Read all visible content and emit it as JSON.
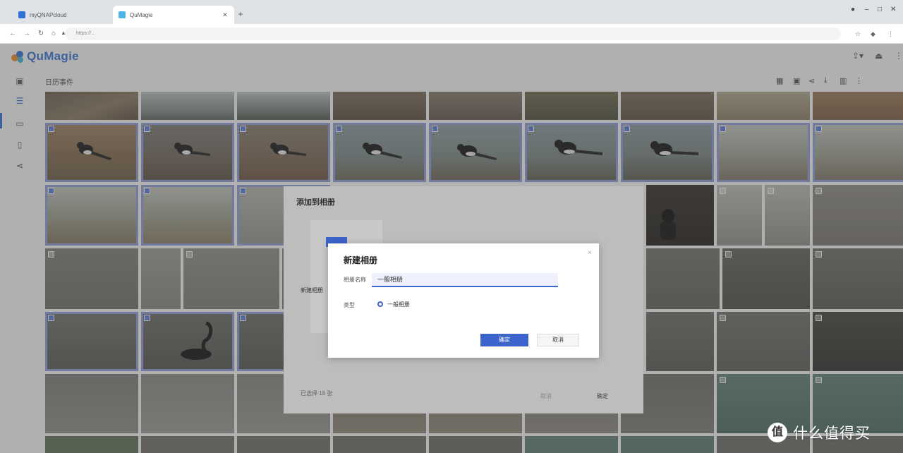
{
  "browser": {
    "tabs": [
      {
        "label": "myQNAPcloud",
        "active": false
      },
      {
        "label": "QuMagie",
        "active": true
      }
    ],
    "new_tab": "+",
    "url": "https://..."
  },
  "app": {
    "name": "QuMagie",
    "breadcrumb": "日历事件"
  },
  "outer_dialog": {
    "title": "添加到相册",
    "side_label": "新建相册",
    "bottom_left": "已选择 18 张",
    "btn_a": "取消",
    "btn_b": "确定"
  },
  "inner_dialog": {
    "title": "新建相册",
    "name_label": "相册名称",
    "name_value": "一般相册",
    "type_label": "类型",
    "type_value": "一般相册",
    "confirm_label": "确定",
    "cancel_label": "取消",
    "close_glyph": "×"
  },
  "watermark": {
    "badge": "值",
    "text": "什么值得买"
  },
  "colors": {
    "accent": "#3d63cc",
    "selection": "#8f9ddd",
    "overlay": "rgba(80,80,80,0.45)"
  },
  "icons": {
    "sidebar": [
      "photo-icon",
      "timeline-icon",
      "video-icon",
      "folder-icon",
      "share-icon"
    ],
    "toolbar": [
      "grid-icon",
      "select-icon",
      "share-icon",
      "download-icon",
      "delete-icon",
      "more-icon"
    ],
    "header": [
      "upload-icon",
      "notification-icon",
      "user-menu-icon"
    ]
  }
}
